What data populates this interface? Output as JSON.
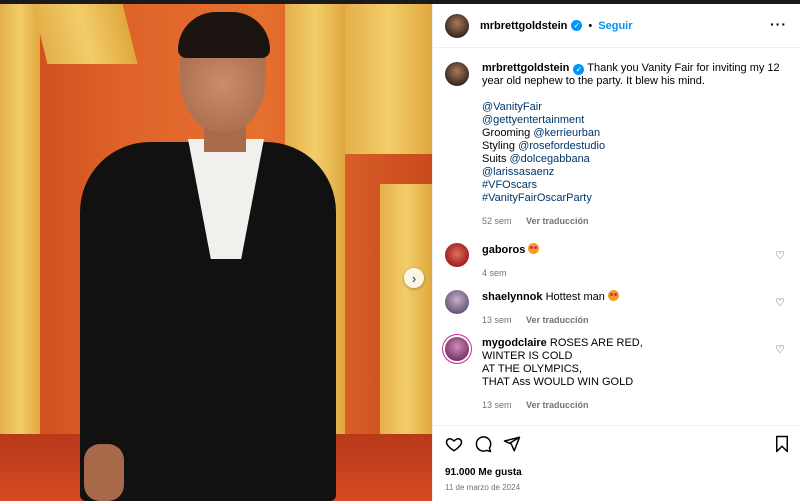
{
  "post": {
    "username": "mrbrettgoldstein",
    "follow_label": "Seguir",
    "caption": "Thank you Vanity Fair for inviting my 12 year old nephew to the party. It blew his mind.",
    "caption_lines": [
      "@VanityFair",
      "@gettyentertainment",
      "Grooming @kerrieurban",
      "Styling @roseforde studio",
      "Suits @dolcegabbana",
      "@larissasaenz",
      "#VFOscars",
      "#VanityFairOscarParty"
    ],
    "time": "52 sem",
    "translate_label": "Ver traducción",
    "likes": "91.000 Me gusta",
    "date": "11 de marzo de 2024"
  },
  "caption_parts": {
    "l1": "@VanityFair",
    "l2": "@gettyentertainment",
    "l3_pre": "Grooming ",
    "l3_link": "@kerrieurban",
    "l4_pre": "Styling ",
    "l4_link": "@rosefordestudio",
    "l5_pre": "Suits ",
    "l5_link": "@dolcegabbana",
    "l6": "@larissasaenz",
    "l7": "#VFOscars",
    "l8": "#VanityFairOscarParty"
  },
  "comments": [
    {
      "username": "gaboros",
      "text": "",
      "emoji": "heart-eyes",
      "time": "4 sem",
      "translate": ""
    },
    {
      "username": "shaelynnok",
      "text": "Hottest man",
      "emoji": "heart-eyes",
      "time": "13 sem",
      "translate": "Ver traducción"
    },
    {
      "username": "mygodclaire",
      "text_lines": [
        "ROSES ARE RED,",
        "WINTER IS COLD",
        "AT THE OLYMPICS,",
        "THAT Ass WOULD WIN GOLD"
      ],
      "time": "13 sem",
      "translate": "Ver traducción"
    }
  ],
  "icons": {
    "more": "more-horizontal-icon",
    "verified": "verified-badge-icon",
    "like": "heart-icon",
    "comment": "comment-icon",
    "share": "share-icon",
    "save": "bookmark-icon",
    "next": "chevron-right-icon"
  },
  "colors": {
    "accent": "#0095f6",
    "link": "#00376b",
    "muted": "#737373"
  }
}
